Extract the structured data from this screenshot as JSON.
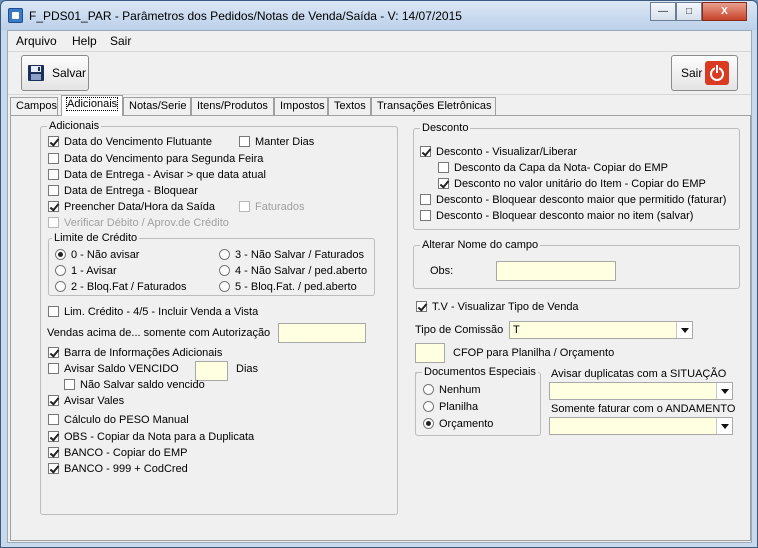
{
  "window": {
    "title": "F_PDS01_PAR - Parâmetros dos Pedidos/Notas de Venda/Saída - V: 14/07/2015",
    "minimize_glyph": "—",
    "maximize_glyph": "□",
    "close_glyph": "X"
  },
  "menu": {
    "arquivo": "Arquivo",
    "help": "Help",
    "sair": "Sair"
  },
  "toolbar": {
    "save_label": "Salvar",
    "exit_label": "Sair"
  },
  "tabs": [
    "Campos",
    "Adicionais",
    "Notas/Serie",
    "Itens/Produtos",
    "Impostos",
    "Textos",
    "Transações Eletrônicas"
  ],
  "adicionais": {
    "group_label": "Adicionais",
    "venc_flutuante": "Data do Vencimento Flutuante",
    "manter_dias": "Manter Dias",
    "venc_segunda": "Data do Vencimento para Segunda Feira",
    "entrega_avisar": "Data de Entrega - Avisar > que data atual",
    "entrega_bloquear": "Data de Entrega - Bloquear",
    "preencher_saida": "Preencher Data/Hora da Saída",
    "faturados": "Faturados",
    "verificar_debito": "Verificar Débito / Aprov.de Crédito",
    "limite": {
      "label": "Limite de Crédito",
      "r0": "0 - Não avisar",
      "r1": "1 - Avisar",
      "r2": "2 - Bloq.Fat / Faturados",
      "r3": "3 - Não Salvar / Faturados",
      "r4": "4 - Não Salvar / ped.aberto",
      "r5": "5 - Bloq.Fat. / ped.aberto"
    },
    "lim_credito": "Lim. Crédito - 4/5 - Incluir Venda a Vista",
    "vendas_acima": "Vendas acima de... somente com Autorização",
    "barra_info": "Barra de Informações Adicionais",
    "avisar_saldo": "Avisar Saldo VENCIDO",
    "dias": "Dias",
    "nao_salvar_saldo": "Não Salvar saldo vencido",
    "avisar_vales": "Avisar Vales",
    "calculo_peso": "Cálculo do PESO Manual",
    "obs_copiar": "OBS - Copiar da Nota para a Duplicata",
    "banco_emp": "BANCO - Copiar do EMP",
    "banco_999": "BANCO - 999 + CodCred"
  },
  "desconto": {
    "group_label": "Desconto",
    "visualizar": "Desconto - Visualizar/Liberar",
    "capa_nota": "Desconto da Capa da Nota- Copiar do EMP",
    "valor_unitario": "Desconto no valor unitário do Item - Copiar do EMP",
    "bloquear_maior": "Desconto - Bloquear desconto maior que permitido (faturar)",
    "bloquear_item": "Desconto - Bloquear desconto maior no item (salvar)"
  },
  "alterar": {
    "group_label": "Alterar Nome do campo",
    "obs_label": "Obs:"
  },
  "tv": {
    "visualizar": "T.V - Visualizar Tipo de Venda",
    "tipo_comissao_label": "Tipo de Comissão",
    "tipo_comissao_value": "T",
    "cfop_label": "CFOP para Planilha / Orçamento"
  },
  "docs": {
    "group_label": "Documentos Especiais",
    "nenhum": "Nenhum",
    "planilha": "Planilha",
    "orcamento": "Orçamento"
  },
  "avisar_dup": {
    "label": "Avisar duplicatas com a SITUAÇÃO",
    "value": ""
  },
  "somente_faturar": {
    "label": "Somente faturar com o ANDAMENTO",
    "value": ""
  }
}
